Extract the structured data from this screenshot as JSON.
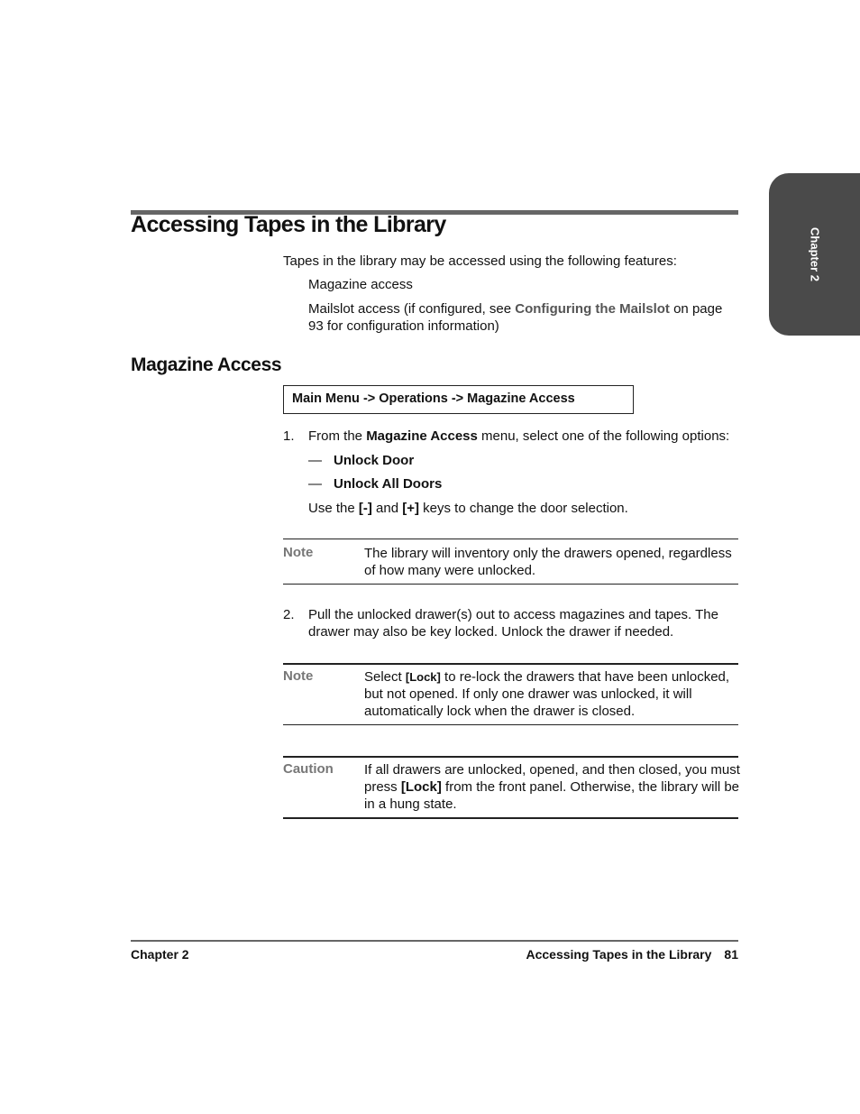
{
  "chapter_tab": "Chapter 2",
  "title": "Accessing Tapes in the Library",
  "intro": "Tapes in the library may be accessed using the following features:",
  "features": [
    {
      "text": "Magazine access"
    },
    {
      "pre": "Mailslot access (if configured, see ",
      "link": "Configuring the Mailslot",
      "post": " on page 93 for configuration information)"
    }
  ],
  "section": {
    "title": "Magazine Access",
    "menu_path": "Main Menu -> Operations -> Magazine Access",
    "step1": {
      "num": "1.",
      "pre": "From the ",
      "bold": "Magazine Access",
      "post": " menu, select one of the following options:",
      "options": [
        "Unlock Door",
        "Unlock All Doors"
      ],
      "dash": "—",
      "keys_pre": "Use the ",
      "key_minus": "[-]",
      "keys_mid": " and ",
      "key_plus": "[+]",
      "keys_post": " keys to change the door selection."
    },
    "note1": {
      "label": "Note",
      "text": "The library will inventory only the drawers opened, regardless of how many were unlocked."
    },
    "step2": {
      "num": "2.",
      "text": "Pull the unlocked drawer(s) out to access magazines and tapes. The drawer may also be key locked. Unlock the drawer if needed."
    },
    "note2": {
      "label": "Note",
      "pre": "Select ",
      "bold": "[Lock]",
      "post": " to re-lock the drawers that have been unlocked, but not opened. If only one drawer was unlocked, it will automatically lock when the drawer is closed."
    },
    "caution": {
      "label": "Caution",
      "pre": "If all drawers are unlocked, opened, and then closed, you must press ",
      "bold": "[Lock]",
      "post": " from the front panel. Otherwise, the library will be in a hung state."
    }
  },
  "footer": {
    "left": "Chapter 2",
    "right": "Accessing Tapes in the Library",
    "page": "81"
  }
}
